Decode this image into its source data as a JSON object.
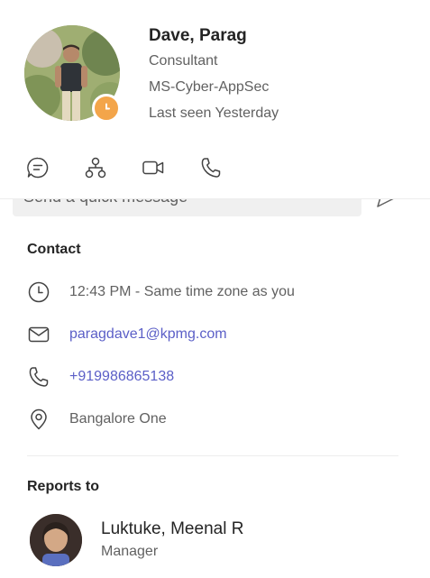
{
  "profile": {
    "name": "Dave, Parag",
    "title": "Consultant",
    "department": "MS-Cyber-AppSec",
    "last_seen": "Last seen Yesterday",
    "presence_status_color": "#f3a54a",
    "presence_icon": "clock-icon"
  },
  "actions": [
    {
      "icon": "chat-icon"
    },
    {
      "icon": "org-chart-icon"
    },
    {
      "icon": "video-call-icon"
    },
    {
      "icon": "phone-call-icon"
    }
  ],
  "quick_message": {
    "placeholder": "Send a quick message",
    "send_icon": "send-icon"
  },
  "contact": {
    "title": "Contact",
    "local_time": "12:43 PM - Same time zone as you",
    "email": "paragdave1@kpmg.com",
    "phone": "+919986865138",
    "location": "Bangalore One"
  },
  "reports_to": {
    "title": "Reports to",
    "name": "Luktuke, Meenal R",
    "role": "Manager"
  },
  "colors": {
    "link": "#5b5fc7",
    "secondary_text": "#616161",
    "primary_text": "#242424"
  }
}
